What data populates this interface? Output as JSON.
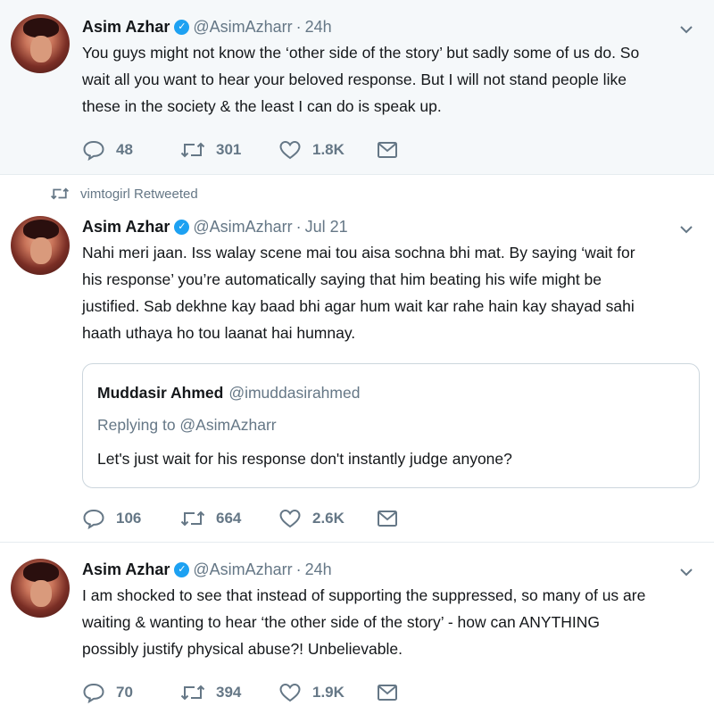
{
  "tweets": [
    {
      "author": "Asim Azhar",
      "handle": "@AsimAzharr",
      "separator": "·",
      "time": "24h",
      "lines": [
        "You guys might not know the ‘other side of the story’ but sadly some of us do. So",
        "wait all you want to hear your beloved response. But I will not stand people like",
        "these in the society & the least I can do is speak up."
      ],
      "replies": "48",
      "retweets": "301",
      "likes": "1.8K"
    },
    {
      "retweeted_by": "vimtogirl Retweeted",
      "author": "Asim Azhar",
      "handle": "@AsimAzharr",
      "separator": "·",
      "time": "Jul 21",
      "lines": [
        "Nahi meri jaan. Iss walay scene mai tou aisa sochna bhi mat. By saying ‘wait for",
        "his response’ you’re automatically saying that him beating his wife might be",
        "justified. Sab dekhne kay baad bhi agar hum wait kar rahe hain kay shayad sahi",
        "haath uthaya ho tou laanat hai humnay."
      ],
      "quote": {
        "author": "Muddasir Ahmed",
        "handle": "@imuddasirahmed",
        "replying_to": "Replying to @AsimAzharr",
        "text": "Let's just wait for his response don't instantly judge anyone?"
      },
      "replies": "106",
      "retweets": "664",
      "likes": "2.6K"
    },
    {
      "author": "Asim Azhar",
      "handle": "@AsimAzharr",
      "separator": "·",
      "time": "24h",
      "lines": [
        "I am shocked to see that instead of supporting the suppressed, so many of us are",
        "waiting & wanting to hear ‘the other side of the story’ - how can ANYTHING",
        "possibly justify physical abuse?! Unbelievable."
      ],
      "replies": "70",
      "retweets": "394",
      "likes": "1.9K"
    }
  ],
  "icons": {
    "verified": "verified-badge-icon",
    "reply": "reply-icon",
    "retweet": "retweet-icon",
    "like": "heart-icon",
    "dm": "envelope-icon",
    "menu": "chevron-down-icon"
  },
  "colors": {
    "verified_blue": "#1da1f2",
    "muted_gray": "#657786",
    "first_tweet_bg": "#f5f8fa"
  }
}
